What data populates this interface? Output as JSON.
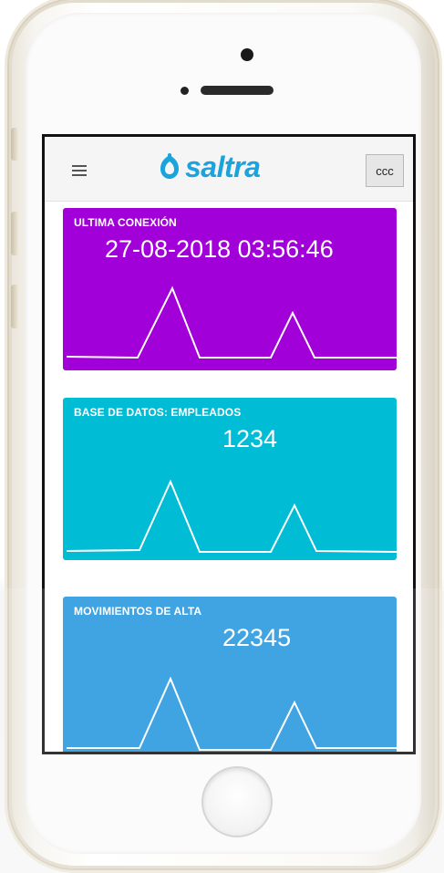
{
  "app": {
    "logo_text": "saltra",
    "menu_icon": "hamburger-menu-icon",
    "account_button_label": "ccc",
    "brand_color": "#1aa3dc"
  },
  "cards": [
    {
      "title": "ULTIMA CONEXIÓN",
      "value": "27-08-2018 03:56:46",
      "color": "#a100d9"
    },
    {
      "title": "BASE DE DATOS: EMPLEADOS",
      "value": "1234",
      "color": "#00bcd4"
    },
    {
      "title": "MOVIMIENTOS DE ALTA",
      "value": "22345",
      "color": "#2196df"
    }
  ]
}
